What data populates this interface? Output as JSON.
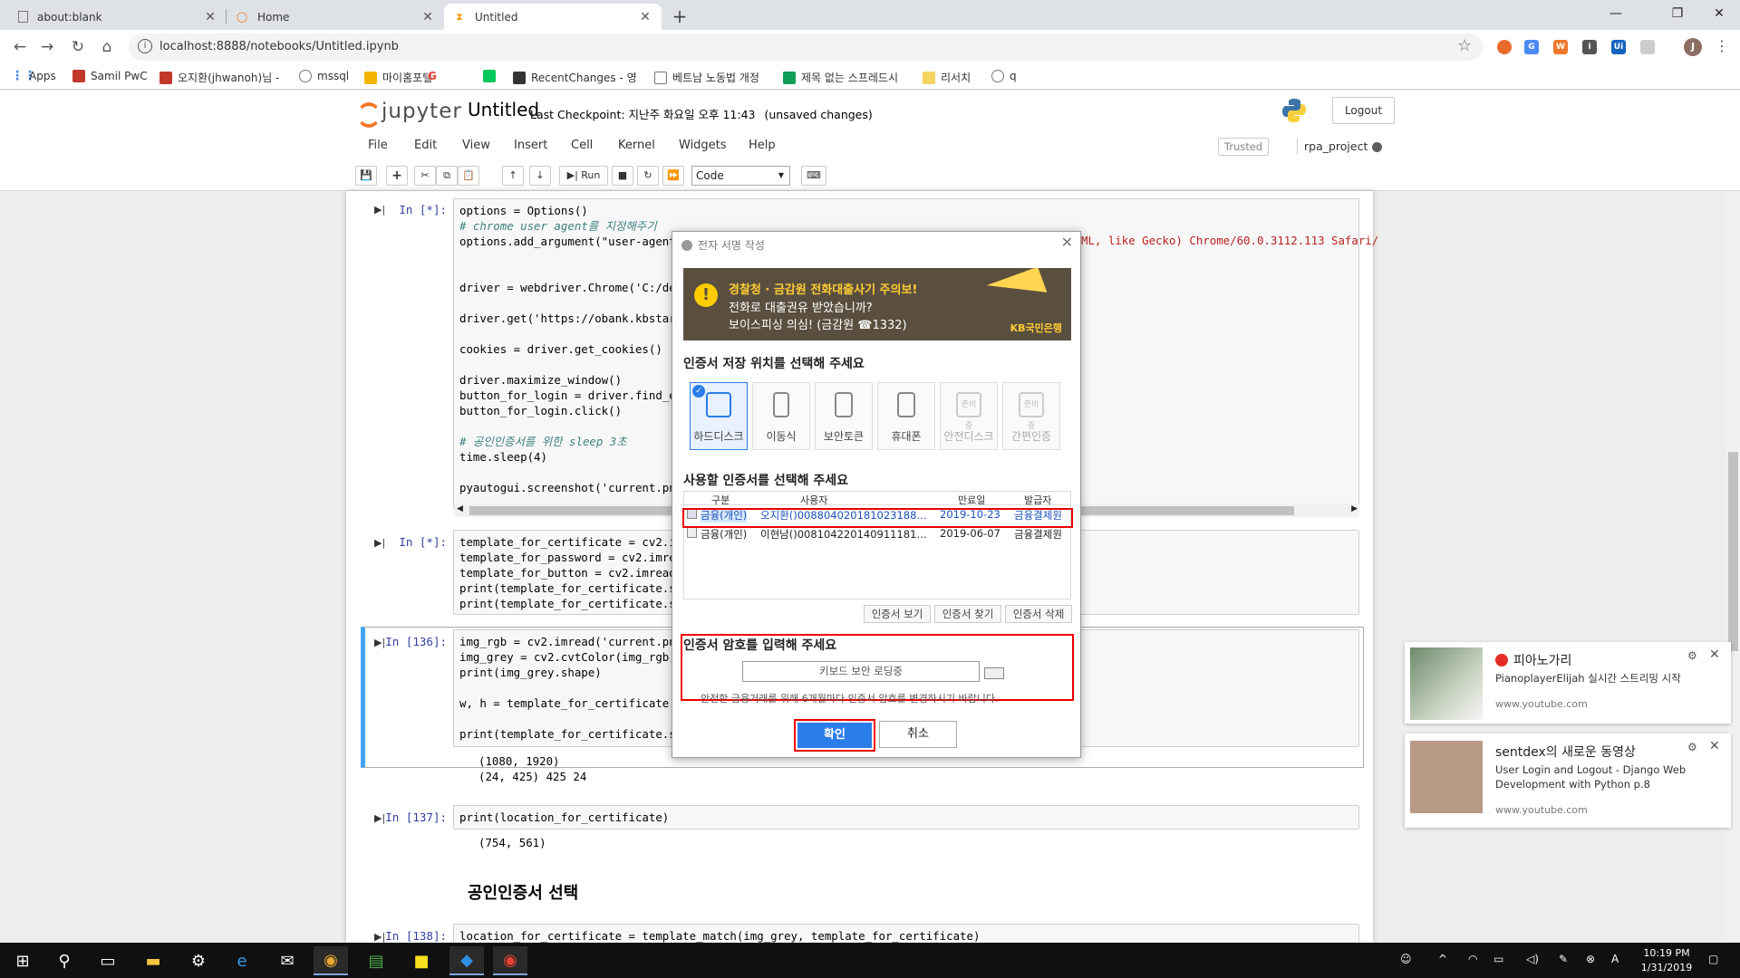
{
  "browser": {
    "tabs": [
      {
        "label": "about:blank",
        "icon": "page-icon"
      },
      {
        "label": "Home",
        "icon": "jupyter-icon"
      },
      {
        "label": "Untitled",
        "icon": "hourglass-icon"
      }
    ],
    "url": "localhost:8888/notebooks/Untitled.ipynb",
    "bookmarks": [
      "Apps",
      "Samil PwC",
      "오지환(jhwanoh)님 -",
      "mssql",
      "마이홈포털",
      "G",
      "N",
      "RecentChanges - 영",
      "베트남 노동법 개정",
      "제목 없는 스프레드시",
      "리서치",
      "q"
    ]
  },
  "jupyter": {
    "logo": "jupyter",
    "title": "Untitled",
    "checkpoint": "Last Checkpoint: 지난주 화요일 오후 11:43",
    "unsaved": "(unsaved changes)",
    "logout": "Logout",
    "menu": [
      "File",
      "Edit",
      "View",
      "Insert",
      "Cell",
      "Kernel",
      "Widgets",
      "Help"
    ],
    "trusted": "Trusted",
    "kernel": "rpa_project",
    "run_label": "Run",
    "cell_type": "Code"
  },
  "cells": [
    {
      "prompt": "In [*]:",
      "code": [
        "options = Options()",
        "# chrome user agent를 지정해주기",
        "options.add_argument(\"user-agent=M",
        "",
        "",
        "driver = webdriver.Chrome('C:/dev/",
        "",
        "driver.get('https://obank.kbstar.c",
        "",
        "cookies = driver.get_cookies()",
        "",
        "driver.maximize_window()",
        "button_for_login = driver.find_ele",
        "button_for_login.click()",
        "",
        "# 공인인증서를 위한 sleep 3초",
        "time.sleep(4)",
        "",
        "pyautogui.screenshot('current.png'"
      ],
      "code_overflow": "ML, like Gecko) Chrome/60.0.3112.113 Safari/"
    },
    {
      "prompt": "In [*]:",
      "code": [
        "template_for_certificate = cv2.imr",
        "template_for_password = cv2.imread",
        "template_for_button = cv2.imread(",
        "print(template_for_certificate.sha",
        "print(template_for_certificate.sha"
      ]
    },
    {
      "prompt": "In [136]:",
      "code": [
        "img_rgb = cv2.imread('current.png'",
        "img_grey = cv2.cvtColor(img_rgb, c",
        "print(img_grey.shape)",
        "",
        "w, h = template_for_certificate.sh",
        "",
        "print(template_for_certificate.sha"
      ],
      "output": [
        "(1080, 1920)",
        "(24, 425) 425 24"
      ]
    },
    {
      "prompt": "In [137]:",
      "code": [
        "print(location_for_certificate)"
      ],
      "output": [
        "(754, 561)"
      ]
    },
    {
      "markdown": "공인인증서 선택"
    },
    {
      "prompt": "In [138]:",
      "code": [
        "location_for_certificate = template_match(img_grey, template_for_certificate)"
      ]
    }
  ],
  "dialog": {
    "title": "전자 서명 작성",
    "banner": {
      "line1": "경찰청 · 금감원 전화대출사기 주의보!",
      "line2": "전화로 대출권유 받았습니까?",
      "line3": "보이스피싱 의심! (금감원 ☎1332)",
      "brand": "KB국민은행"
    },
    "storage_heading": "인증서 저장 위치를 선택해 주세요",
    "storage": [
      {
        "label": "하드디스크",
        "selected": true
      },
      {
        "label": "이동식"
      },
      {
        "label": "보안토큰"
      },
      {
        "label": "휴대폰"
      },
      {
        "label": "안전디스크",
        "disabled": true,
        "badge": "준비중"
      },
      {
        "label": "간편인증",
        "disabled": true,
        "badge": "준비중"
      }
    ],
    "cert_heading": "사용할 인증서를 선택해 주세요",
    "cert_columns": [
      "구분",
      "사용자",
      "만료일",
      "발급자"
    ],
    "certs": [
      {
        "type": "금융(개인)",
        "user": "오지환()0088040201810231880012",
        "expires": "2019-10-23",
        "issuer": "금융결제원"
      },
      {
        "type": "금융(개인)",
        "user": "이현남()0081042201409111810002",
        "expires": "2019-06-07",
        "issuer": "금융결제원"
      }
    ],
    "cert_buttons": [
      "인증서 보기",
      "인증서 찾기",
      "인증서 삭제"
    ],
    "pw_heading": "인증서 암호를 입력해 주세요",
    "pw_placeholder": "키보드 보안 로딩중",
    "pw_note": "안전한 금융거래를 위해 6개월마다 인증서 암호를 변경하시기 바랍니다.",
    "ok": "확인",
    "cancel": "취소"
  },
  "notifications": [
    {
      "title": "피아노가리",
      "text": "PianoplayerElijah 실시간 스트리밍 시작",
      "source": "www.youtube.com"
    },
    {
      "title": "sentdex의 새로운 동영상",
      "text": "User Login and Logout - Django Web Development with Python p.8",
      "source": "www.youtube.com"
    }
  ],
  "taskbar": {
    "time": "10:19 PM",
    "date": "1/31/2019"
  }
}
